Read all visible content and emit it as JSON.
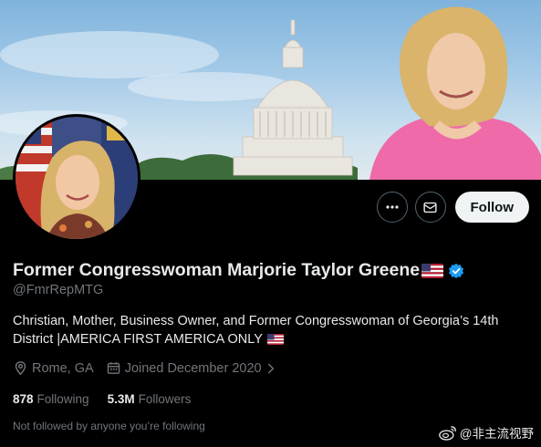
{
  "profile": {
    "display_name": "Former Congresswoman Marjorie Taylor Greene",
    "handle": "@FmrRepMTG",
    "bio_line1": "Christian, Mother, Business Owner, and Former Congresswoman of Georgia’s 14th",
    "bio_line2": "District |AMERICA FIRST AMERICA ONLY",
    "location": "Rome, GA",
    "joined": "Joined December 2020",
    "following_count": "878",
    "following_label": "Following",
    "followers_count": "5.3M",
    "followers_label": "Followers",
    "not_followed_text": "Not followed by anyone you’re following"
  },
  "actions": {
    "follow_label": "Follow"
  },
  "icons": {
    "more": "more-icon",
    "message": "envelope-icon",
    "verified": "verified-badge-icon",
    "location": "location-pin-icon",
    "calendar": "calendar-icon",
    "chevron": "chevron-right-icon",
    "flag": "us-flag-icon"
  },
  "watermark": {
    "text": "@非主流视野"
  },
  "colors": {
    "background": "#000000",
    "primary_text": "#e7e9ea",
    "secondary_text": "#71767b",
    "verified_blue": "#1d9bf0",
    "follow_button_bg": "#eff3f4"
  }
}
